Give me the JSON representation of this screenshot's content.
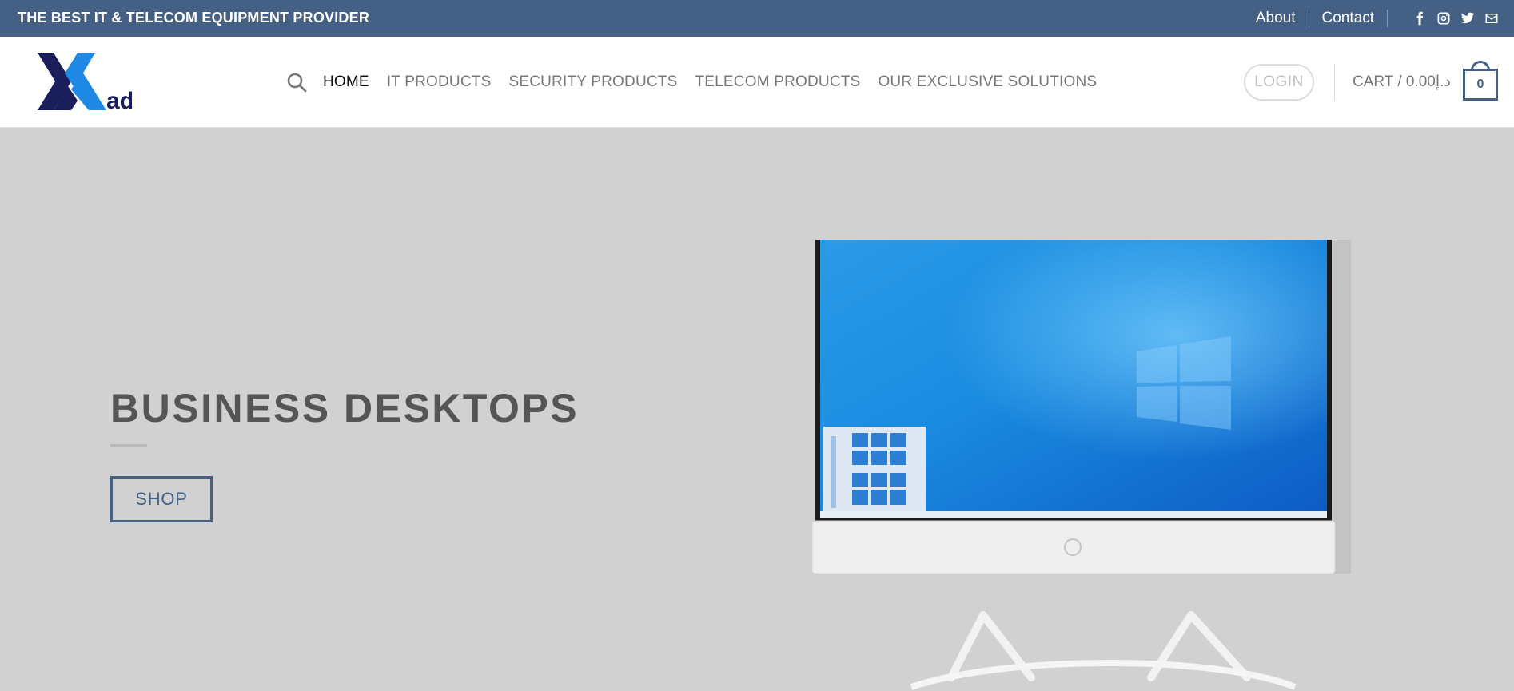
{
  "topbar": {
    "tagline": "THE BEST IT & TELECOM EQUIPMENT PROVIDER",
    "links": [
      "About",
      "Contact"
    ],
    "social_icons": [
      "facebook-icon",
      "instagram-icon",
      "twitter-icon",
      "envelope-icon"
    ]
  },
  "header": {
    "logo_text": "ad",
    "nav": [
      "HOME",
      "IT PRODUCTS",
      "SECURITY PRODUCTS",
      "TELECOM PRODUCTS",
      "OUR EXCLUSIVE SOLUTIONS"
    ],
    "login_label": "LOGIN",
    "cart_label": "CART / 0.00د.إ",
    "cart_count": "0"
  },
  "hero": {
    "title": "BUSINESS DESKTOPS",
    "button_label": "SHOP",
    "image": "hp-all-in-one-desktop"
  },
  "colors": {
    "brand_blue": "#446084",
    "logo_navy": "#1a1f5c",
    "logo_light_blue": "#1e88e5",
    "hero_bg": "#d1d1d1"
  }
}
